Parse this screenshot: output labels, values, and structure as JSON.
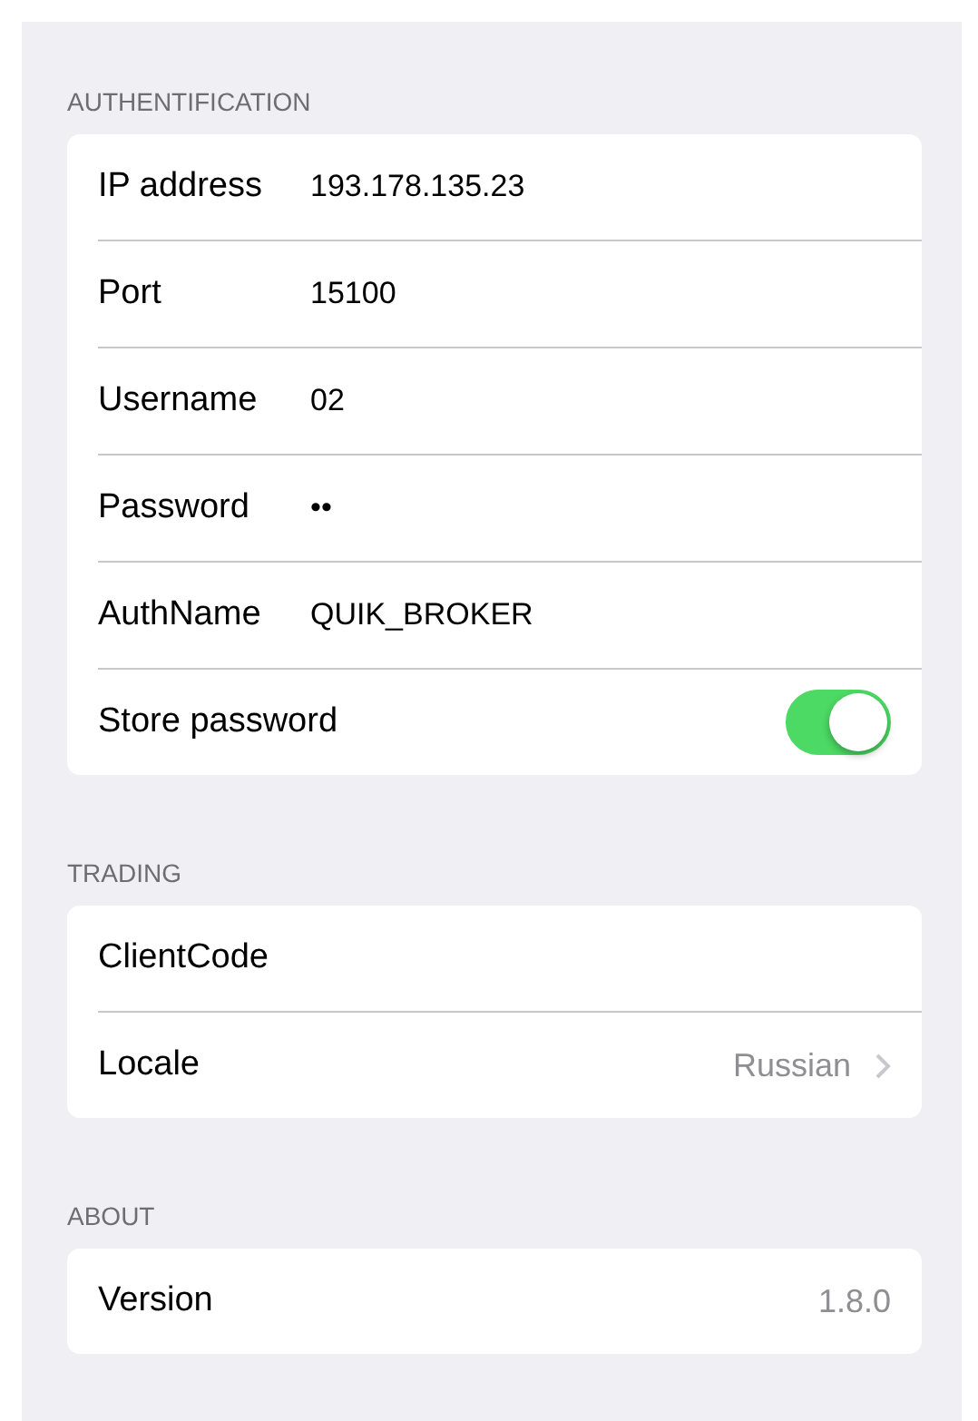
{
  "sections": [
    {
      "header": "AUTHENTIFICATION",
      "rows": [
        {
          "kind": "field",
          "label": "IP address",
          "value": "193.178.135.23"
        },
        {
          "kind": "field",
          "label": "Port",
          "value": "15100"
        },
        {
          "kind": "field",
          "label": "Username",
          "value": "02"
        },
        {
          "kind": "field",
          "label": "Password",
          "value": "••"
        },
        {
          "kind": "field",
          "label": "AuthName",
          "value": "QUIK_BROKER"
        },
        {
          "kind": "toggle",
          "label": "Store password",
          "on": true
        }
      ]
    },
    {
      "header": "TRADING",
      "rows": [
        {
          "kind": "field",
          "label": "ClientCode"
        },
        {
          "kind": "disclosure",
          "label": "Locale",
          "value": "Russian"
        }
      ]
    },
    {
      "header": "ABOUT",
      "rows": [
        {
          "kind": "info",
          "label": "Version",
          "value": "1.8.0"
        }
      ]
    }
  ]
}
